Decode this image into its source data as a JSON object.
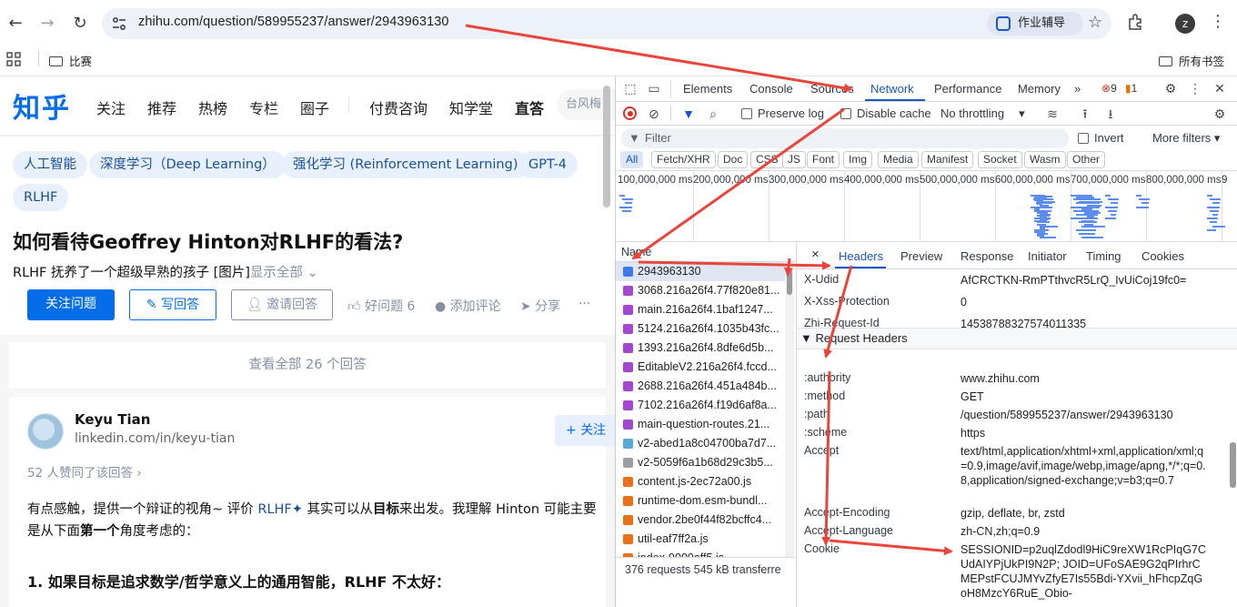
{
  "browser": {
    "url": "zhihu.com/question/589955237/answer/2943963130",
    "assist_label": "作业辅导",
    "profile_initial": "z",
    "bookmarks": [
      {
        "label": "比赛"
      },
      {
        "label": "所有书签"
      }
    ]
  },
  "zhihu": {
    "logo": "知乎",
    "nav": [
      "关注",
      "推荐",
      "热榜",
      "专栏",
      "圈子",
      "付费咨询",
      "知学堂",
      "直答"
    ],
    "search_placeholder": "台风梅",
    "tags": [
      "人工智能",
      "深度学习（Deep Learning）",
      "强化学习 (Reinforcement Learning)",
      "GPT-4",
      "RLHF"
    ],
    "question_title": "如何看待Geoffrey Hinton对RLHF的看法?",
    "question_desc": "RLHF 抚养了一个超级早熟的孩子 [图片]",
    "question_more": "显示全部",
    "follow_btn": "关注问题",
    "write_btn": "写回答",
    "invite_btn": "邀请回答",
    "good_q": "好问题 6",
    "add_comment": "添加评论",
    "share": "分享",
    "more": "···",
    "all_answers": "查看全部 26 个回答",
    "answer": {
      "author": "Keyu Tian",
      "bio": "linkedin.com/in/keyu-tian",
      "follow": "关注",
      "votes": "52 人赞同了该回答 ›",
      "para1_a": "有点感触，提供一个辩证的视角~ 评价 ",
      "para1_link": "RLHF",
      "para1_b": " 其实可以从",
      "para1_bold": "目标",
      "para1_c": "来出发。我理解 Hinton 可能主要是从下面",
      "para1_bold2": "第一个",
      "para1_d": "角度考虑的：",
      "heading": "1. 如果目标是追求数学/哲学意义上的通用智能，RLHF 不太好："
    }
  },
  "devtools": {
    "tabs": [
      "Elements",
      "Console",
      "Sources",
      "Network",
      "Performance",
      "Memory"
    ],
    "active_tab": "Network",
    "error_count": "9",
    "warn_count": "1",
    "preserve_log": "Preserve log",
    "disable_cache": "Disable cache",
    "throttling": "No throttling",
    "filter_placeholder": "Filter",
    "invert": "Invert",
    "more_filters": "More filters",
    "types": [
      "All",
      "Fetch/XHR",
      "Doc",
      "CSS",
      "JS",
      "Font",
      "Img",
      "Media",
      "Manifest",
      "Socket",
      "Wasm",
      "Other"
    ],
    "ticks": [
      "100,000,000 ms",
      "200,000,000 ms",
      "300,000,000 ms",
      "400,000,000 ms",
      "500,000,000 ms",
      "600,000,000 ms",
      "700,000,000 ms",
      "800,000,000 ms",
      "9"
    ],
    "name_header": "Name",
    "requests": [
      {
        "name": "2943963130",
        "color": "#3e7be6"
      },
      {
        "name": "3068.216a26f4.77f820e81...",
        "color": "#a347d1"
      },
      {
        "name": "main.216a26f4.1baf1247...",
        "color": "#a347d1"
      },
      {
        "name": "5124.216a26f4.1035b43fc...",
        "color": "#a347d1"
      },
      {
        "name": "1393.216a26f4.8dfe6d5b...",
        "color": "#a347d1"
      },
      {
        "name": "EditableV2.216a26f4.fccd...",
        "color": "#a347d1"
      },
      {
        "name": "2688.216a26f4.451a484b...",
        "color": "#a347d1"
      },
      {
        "name": "7102.216a26f4.f19d6af8a...",
        "color": "#a347d1"
      },
      {
        "name": "main-question-routes.21...",
        "color": "#a347d1"
      },
      {
        "name": "v2-abed1a8c04700ba7d7...",
        "color": "#5aa7d9"
      },
      {
        "name": "v2-5059f6a1b68d29c3b5...",
        "color": "#9aa0a6"
      },
      {
        "name": "content.js-2ec72a00.js",
        "color": "#e8711a"
      },
      {
        "name": "runtime-dom.esm-bundl...",
        "color": "#e8711a"
      },
      {
        "name": "vendor.2be0f44f82bcffc4...",
        "color": "#e8711a"
      },
      {
        "name": "util-eaf7ff2a.js",
        "color": "#e8711a"
      },
      {
        "name": "index-9000aff5.js",
        "color": "#e8711a"
      }
    ],
    "status": "376 requests   545 kB transferre",
    "detail_tabs": [
      "Headers",
      "Preview",
      "Response",
      "Initiator",
      "Timing",
      "Cookies"
    ],
    "close_x": "×",
    "response_headers": [
      {
        "k": "X-Udid",
        "v": "AfCRCTKN-RmPTthvcR5LrQ_IvUiCoj19fc0="
      },
      {
        "k": "X-Xss-Protection",
        "v": "0"
      },
      {
        "k": "Zhi-Request-Id",
        "v": "14538788327574011335"
      }
    ],
    "request_headers_title": "▼ Request Headers",
    "request_headers": [
      {
        "k": ":authority",
        "v": "www.zhihu.com"
      },
      {
        "k": ":method",
        "v": "GET"
      },
      {
        "k": ":path",
        "v": "/question/589955237/answer/2943963130"
      },
      {
        "k": ":scheme",
        "v": "https"
      },
      {
        "k": "Accept",
        "v": "text/html,application/xhtml+xml,application/xml;q=0.9,image/avif,image/webp,image/apng,*/*;q=0.8,application/signed-exchange;v=b3;q=0.7"
      },
      {
        "k": "Accept-Encoding",
        "v": "gzip, deflate, br, zstd"
      },
      {
        "k": "Accept-Language",
        "v": "zh-CN,zh;q=0.9"
      },
      {
        "k": "Cookie",
        "v": "SESSIONID=p2uqlZdodl9HiC9reXW1RcPIqG7CUdAIYPjUkPI9N2P; JOID=UFoSAE9G2qPIrhrCMEPstFCUJMYvZfyE7Is55Bdi-YXvii_hFhcpZqGoH8MzcY6RuE_Obio-"
      }
    ],
    "accent": "#1a56c4"
  }
}
